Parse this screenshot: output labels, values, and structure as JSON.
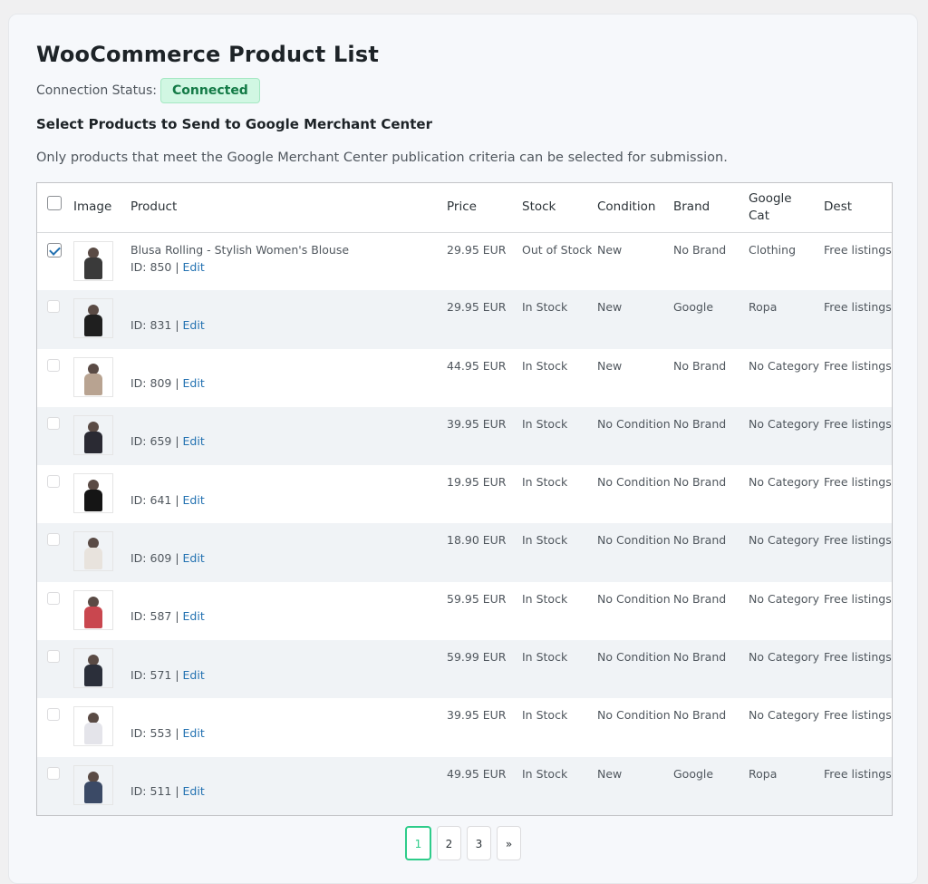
{
  "page": {
    "title": "WooCommerce Product List",
    "connection_label": "Connection Status:",
    "connection_status": "Connected",
    "section_title": "Select Products to Send to Google Merchant Center",
    "description": "Only products that meet the Google Merchant Center publication criteria can be selected for submission."
  },
  "table": {
    "headers": {
      "image": "Image",
      "product": "Product",
      "price": "Price",
      "stock": "Stock",
      "condition": "Condition",
      "brand": "Brand",
      "google_cat": "Google Cat",
      "dest": "Dest"
    },
    "rows": [
      {
        "checked": true,
        "name": "Blusa Rolling - Stylish Women's Blouse",
        "id_text": "ID: 850 |",
        "edit": "Edit",
        "price": "29.95 EUR",
        "stock": "Out of Stock",
        "condition": "New",
        "brand": "No Brand",
        "gcat": "Clothing",
        "dest": "Free listings"
      },
      {
        "checked": false,
        "name": "",
        "id_text": "ID: 831 |",
        "edit": "Edit",
        "price": "29.95 EUR",
        "stock": "In Stock",
        "condition": "New",
        "brand": "Google",
        "gcat": "Ropa",
        "dest": "Free listings"
      },
      {
        "checked": false,
        "name": "",
        "id_text": "ID: 809 |",
        "edit": "Edit",
        "price": "44.95 EUR",
        "stock": "In Stock",
        "condition": "New",
        "brand": "No Brand",
        "gcat": "No Category",
        "dest": "Free listings"
      },
      {
        "checked": false,
        "name": "",
        "id_text": "ID: 659 |",
        "edit": "Edit",
        "price": "39.95 EUR",
        "stock": "In Stock",
        "condition": "No Condition",
        "brand": "No Brand",
        "gcat": "No Category",
        "dest": "Free listings"
      },
      {
        "checked": false,
        "name": "",
        "id_text": "ID: 641 |",
        "edit": "Edit",
        "price": "19.95 EUR",
        "stock": "In Stock",
        "condition": "No Condition",
        "brand": "No Brand",
        "gcat": "No Category",
        "dest": "Free listings"
      },
      {
        "checked": false,
        "name": "",
        "id_text": "ID: 609 |",
        "edit": "Edit",
        "price": "18.90 EUR",
        "stock": "In Stock",
        "condition": "No Condition",
        "brand": "No Brand",
        "gcat": "No Category",
        "dest": "Free listings"
      },
      {
        "checked": false,
        "name": "",
        "id_text": "ID: 587 |",
        "edit": "Edit",
        "price": "59.95 EUR",
        "stock": "In Stock",
        "condition": "No Condition",
        "brand": "No Brand",
        "gcat": "No Category",
        "dest": "Free listings"
      },
      {
        "checked": false,
        "name": "",
        "id_text": "ID: 571 |",
        "edit": "Edit",
        "price": "59.99 EUR",
        "stock": "In Stock",
        "condition": "No Condition",
        "brand": "No Brand",
        "gcat": "No Category",
        "dest": "Free listings"
      },
      {
        "checked": false,
        "name": "",
        "id_text": "ID: 553 |",
        "edit": "Edit",
        "price": "39.95 EUR",
        "stock": "In Stock",
        "condition": "No Condition",
        "brand": "No Brand",
        "gcat": "No Category",
        "dest": "Free listings"
      },
      {
        "checked": false,
        "name": "",
        "id_text": "ID: 511 |",
        "edit": "Edit",
        "price": "49.95 EUR",
        "stock": "In Stock",
        "condition": "New",
        "brand": "Google",
        "gcat": "Ropa",
        "dest": "Free listings"
      }
    ]
  },
  "pagination": {
    "pages": [
      "1",
      "2",
      "3"
    ],
    "current": "1",
    "next": "»"
  },
  "colors": {
    "accent": "#2271b1",
    "connected_bg": "#d1f7e3",
    "connected_text": "#137a46",
    "active_page": "#2ecc8a"
  }
}
